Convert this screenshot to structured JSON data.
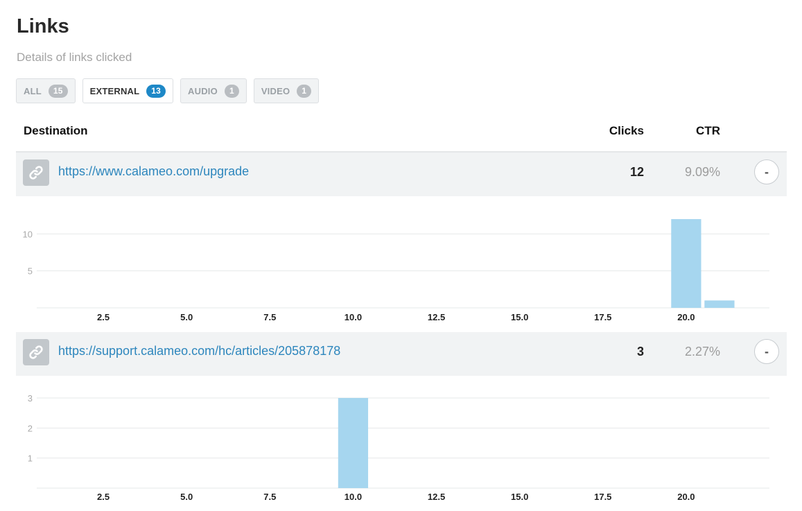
{
  "header": {
    "title": "Links",
    "subtitle": "Details of links clicked"
  },
  "filters": [
    {
      "label": "ALL",
      "count": "15",
      "active": false
    },
    {
      "label": "EXTERNAL",
      "count": "13",
      "active": true
    },
    {
      "label": "AUDIO",
      "count": "1",
      "active": false
    },
    {
      "label": "VIDEO",
      "count": "1",
      "active": false
    }
  ],
  "table": {
    "col_destination": "Destination",
    "col_clicks": "Clicks",
    "col_ctr": "CTR"
  },
  "links": [
    {
      "url": "https://www.calameo.com/upgrade",
      "clicks": "12",
      "ctr": "9.09%",
      "collapse_label": "-"
    },
    {
      "url": "https://support.calameo.com/hc/articles/205878178",
      "clicks": "3",
      "ctr": "2.27%",
      "collapse_label": "-"
    }
  ],
  "colors": {
    "bar": "#a6d6ef",
    "link": "#2d86bd",
    "badge_active": "#1e88c7"
  },
  "icons": {
    "link_icon": "chain-link-icon",
    "collapse_icon": "minus-icon"
  },
  "chart_data": [
    {
      "type": "bar",
      "x": [
        20,
        21
      ],
      "values": [
        12,
        1
      ],
      "xticks": [
        "2.5",
        "5.0",
        "7.5",
        "10.0",
        "12.5",
        "15.0",
        "17.5",
        "20.0"
      ],
      "yticks": [
        "5",
        "10"
      ],
      "xlim": [
        0.5,
        22.5
      ],
      "ylim": [
        0,
        12
      ],
      "grid": true
    },
    {
      "type": "bar",
      "x": [
        10
      ],
      "values": [
        3
      ],
      "xticks": [
        "2.5",
        "5.0",
        "7.5",
        "10.0",
        "12.5",
        "15.0",
        "17.5",
        "20.0"
      ],
      "yticks": [
        "1",
        "2",
        "3"
      ],
      "xlim": [
        0.5,
        22.5
      ],
      "ylim": [
        0,
        3
      ],
      "grid": true
    }
  ]
}
